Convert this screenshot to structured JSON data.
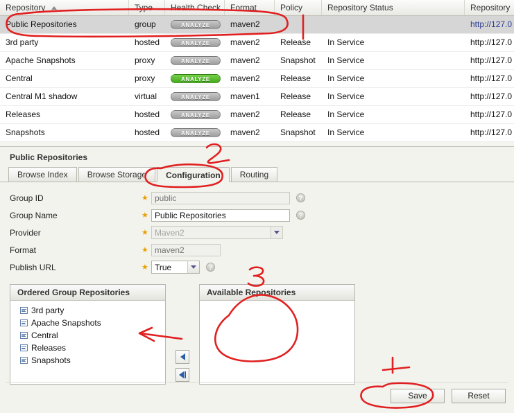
{
  "grid": {
    "columns": [
      {
        "label": "Repository",
        "sorted": true
      },
      {
        "label": "Type"
      },
      {
        "label": "Health Check"
      },
      {
        "label": "Format"
      },
      {
        "label": "Policy"
      },
      {
        "label": "Repository Status"
      },
      {
        "label": "Repository"
      }
    ],
    "health_label": "ANALYZE",
    "rows": [
      {
        "name": "Public Repositories",
        "type": "group",
        "health": "gray",
        "format": "maven2",
        "policy": "",
        "status": "",
        "url": "http://127.0",
        "selected": true
      },
      {
        "name": "3rd party",
        "type": "hosted",
        "health": "gray",
        "format": "maven2",
        "policy": "Release",
        "status": "In Service",
        "url": "http://127.0",
        "selected": false
      },
      {
        "name": "Apache Snapshots",
        "type": "proxy",
        "health": "gray",
        "format": "maven2",
        "policy": "Snapshot",
        "status": "In Service",
        "url": "http://127.0",
        "selected": false
      },
      {
        "name": "Central",
        "type": "proxy",
        "health": "green",
        "format": "maven2",
        "policy": "Release",
        "status": "In Service",
        "url": "http://127.0",
        "selected": false
      },
      {
        "name": "Central M1 shadow",
        "type": "virtual",
        "health": "gray",
        "format": "maven1",
        "policy": "Release",
        "status": "In Service",
        "url": "http://127.0",
        "selected": false
      },
      {
        "name": "Releases",
        "type": "hosted",
        "health": "gray",
        "format": "maven2",
        "policy": "Release",
        "status": "In Service",
        "url": "http://127.0",
        "selected": false
      },
      {
        "name": "Snapshots",
        "type": "hosted",
        "health": "gray",
        "format": "maven2",
        "policy": "Snapshot",
        "status": "In Service",
        "url": "http://127.0",
        "selected": false
      }
    ]
  },
  "detail": {
    "title": "Public Repositories",
    "tabs": [
      {
        "label": "Browse Index",
        "active": false
      },
      {
        "label": "Browse Storage",
        "active": false
      },
      {
        "label": "Configuration",
        "active": true
      },
      {
        "label": "Routing",
        "active": false
      }
    ],
    "fields": [
      {
        "label": "Group ID",
        "value": "public",
        "placeholder": "public",
        "kind": "text",
        "disabled": true,
        "help": true,
        "required": true
      },
      {
        "label": "Group Name",
        "value": "Public Repositories",
        "placeholder": "",
        "kind": "text",
        "disabled": false,
        "help": true,
        "required": true
      },
      {
        "label": "Provider",
        "value": "Maven2",
        "kind": "select",
        "disabled": true,
        "help": false,
        "required": true
      },
      {
        "label": "Format",
        "value": "maven2",
        "placeholder": "maven2",
        "kind": "text",
        "disabled": true,
        "help": false,
        "required": true
      },
      {
        "label": "Publish URL",
        "value": "True",
        "kind": "select",
        "disabled": false,
        "help": true,
        "required": true
      }
    ],
    "ordered_list": {
      "title": "Ordered Group Repositories",
      "items": [
        "3rd party",
        "Apache Snapshots",
        "Central",
        "Releases",
        "Snapshots"
      ]
    },
    "available_list": {
      "title": "Available Repositories",
      "items": []
    },
    "buttons": {
      "save": "Save",
      "reset": "Reset"
    }
  },
  "annotations": {
    "color": "#e02020",
    "marks": [
      "2",
      "3",
      "4"
    ]
  }
}
